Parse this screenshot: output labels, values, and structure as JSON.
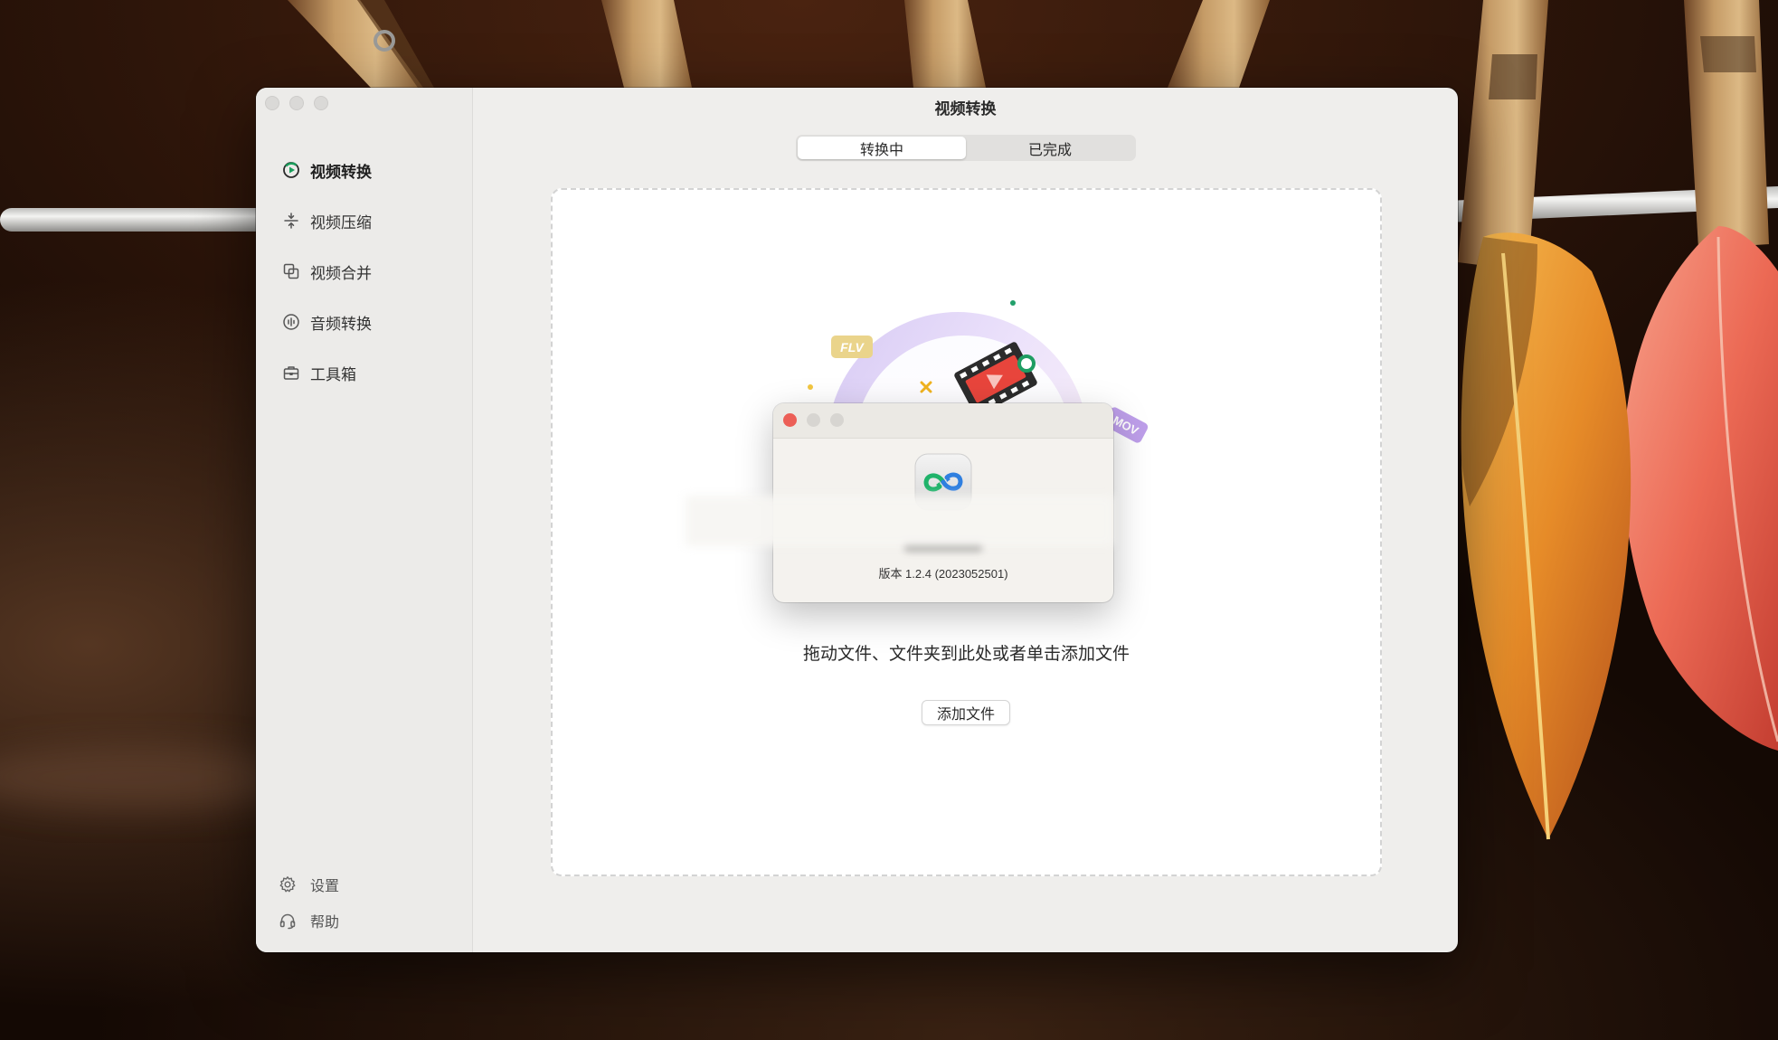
{
  "window": {
    "title": "视频转换"
  },
  "sidebar": {
    "items": [
      {
        "label": "视频转换",
        "icon": "video-convert-icon",
        "active": true
      },
      {
        "label": "视频压缩",
        "icon": "compress-icon",
        "active": false
      },
      {
        "label": "视频合并",
        "icon": "merge-icon",
        "active": false
      },
      {
        "label": "音频转换",
        "icon": "audio-convert-icon",
        "active": false
      },
      {
        "label": "工具箱",
        "icon": "toolbox-icon",
        "active": false
      }
    ],
    "footer": [
      {
        "label": "设置",
        "icon": "gear-icon"
      },
      {
        "label": "帮助",
        "icon": "headset-icon"
      }
    ]
  },
  "tabs": [
    {
      "label": "转换中",
      "selected": true
    },
    {
      "label": "已完成",
      "selected": false
    }
  ],
  "dropzone": {
    "hint": "拖动文件、文件夹到此处或者单击添加文件",
    "add_button": "添加文件",
    "illustration_badges": [
      "FLV",
      "MOV"
    ]
  },
  "about_dialog": {
    "app_icon": "app-logo-icon",
    "version": "版本 1.2.4 (2023052501)"
  },
  "colors": {
    "accent": "#1a9e5c",
    "close_button": "#ec5f57",
    "window_bg": "#efeeec",
    "sidebar_bg": "#ecebe9",
    "dropzone_bg": "#ffffff",
    "badge_flv": "#ead48b",
    "badge_mov": "#bd9ee9"
  }
}
